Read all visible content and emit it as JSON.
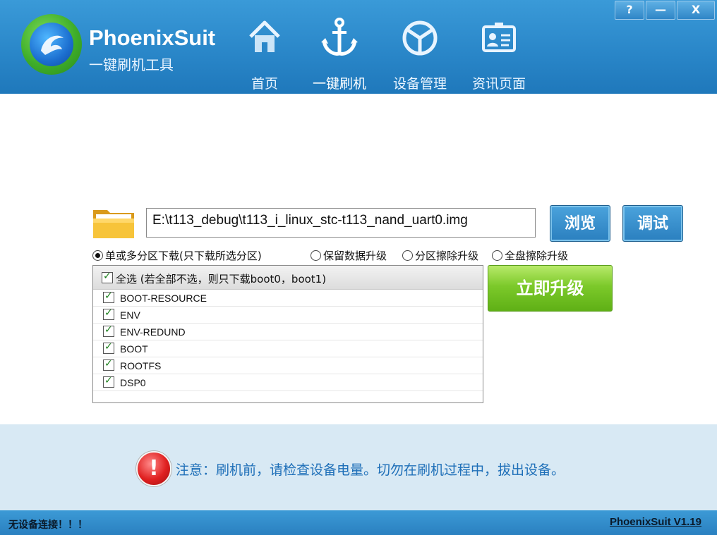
{
  "app": {
    "brand": "PhoenixSuit",
    "subtitle": "一键刷机工具"
  },
  "nav": [
    {
      "label": "首页",
      "icon": "home-icon"
    },
    {
      "label": "一键刷机",
      "icon": "anchor-icon",
      "active": true
    },
    {
      "label": "设备管理",
      "icon": "cube-icon"
    },
    {
      "label": "资讯页面",
      "icon": "id-card-icon"
    }
  ],
  "window_controls": {
    "help": "?",
    "minimize": "—",
    "close": "X"
  },
  "firmware": {
    "path": "E:\\t113_debug\\t113_i_linux_stc-t113_nand_uart0.img",
    "browse_label": "浏览",
    "debug_label": "调试"
  },
  "modes": [
    {
      "label": "单或多分区下载(只下载所选分区)",
      "selected": true
    },
    {
      "label": "保留数据升级",
      "selected": false
    },
    {
      "label": "分区擦除升级",
      "selected": false
    },
    {
      "label": "全盘擦除升级",
      "selected": false
    }
  ],
  "partitions": {
    "select_all_label": "全选 (若全部不选，则只下载boot0，boot1)",
    "items": [
      "BOOT-RESOURCE",
      "ENV",
      "ENV-REDUND",
      "BOOT",
      "ROOTFS",
      "DSP0"
    ]
  },
  "upgrade_label": "立即升级",
  "notice": "注意：刷机前，请检查设备电量。切勿在刷机过程中，拔出设备。",
  "status": {
    "left": "无设备连接！！！",
    "version": "PhoenixSuit V1.19"
  },
  "colors": {
    "header_blue": "#2a87c9",
    "accent_green": "#7cc92a",
    "notice_text": "#1e6fb8",
    "warning_red": "#e02020"
  }
}
